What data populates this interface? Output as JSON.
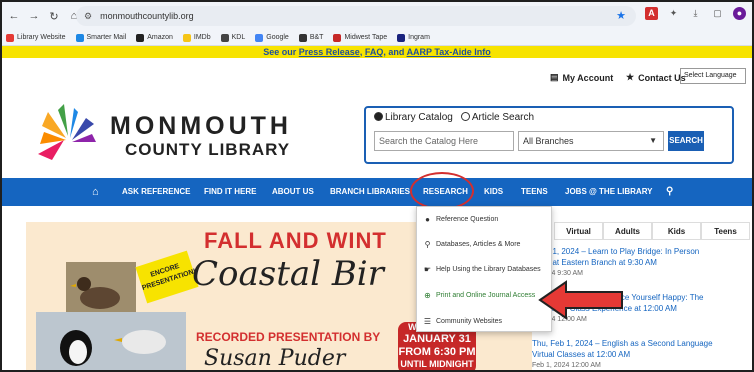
{
  "browser": {
    "url": "monmouthcountylib.org",
    "bookmarks": [
      {
        "label": "Library Website",
        "color": "#e53935"
      },
      {
        "label": "Smarter Mail",
        "color": "#1e88e5"
      },
      {
        "label": "Amazon",
        "color": "#222222"
      },
      {
        "label": "IMDb",
        "color": "#f5c518"
      },
      {
        "label": "KDL",
        "color": "#444444"
      },
      {
        "label": "Google",
        "color": "#4285f4"
      },
      {
        "label": "B&T",
        "color": "#333333"
      },
      {
        "label": "Midwest Tape",
        "color": "#c62828"
      },
      {
        "label": "Ingram",
        "color": "#1a237e"
      }
    ]
  },
  "banner": {
    "prefix": "See our",
    "link1": "Press Release",
    "sep": ",",
    "link2": "FAQ",
    "and": ", and",
    "link3": "AARP Tax-Aide Info"
  },
  "utility": {
    "account": "My Account",
    "contact": "Contact Us",
    "language": "Select Language"
  },
  "logo": {
    "line1": "MONMOUTH",
    "line2": "COUNTY LIBRARY"
  },
  "search": {
    "option1": "Library Catalog",
    "option2": "Article Search",
    "placeholder": "Search the Catalog Here",
    "branch": "All Branches",
    "button": "SEARCH"
  },
  "nav": {
    "items": [
      "ASK REFERENCE",
      "FIND IT HERE",
      "ABOUT US",
      "BRANCH LIBRARIES",
      "RESEARCH",
      "KIDS",
      "TEENS",
      "JOBS @ THE LIBRARY"
    ]
  },
  "dropdown": {
    "items": [
      {
        "label": "Reference Question",
        "icon": "chat-icon"
      },
      {
        "label": "Databases, Articles & More",
        "icon": "search-icon"
      },
      {
        "label": "Help Using the Library Databases",
        "icon": "hand-pointer-icon"
      },
      {
        "label": "Print and Online Journal Access",
        "icon": "plus-circle-icon"
      },
      {
        "label": "Community Websites",
        "icon": "list-icon"
      }
    ]
  },
  "hero": {
    "title": "FALL AND WINT",
    "script": "Coastal Bir",
    "encore": "ENCORE PRESENTATION!",
    "recorded": "RECORDED PRESENTATION BY",
    "name": "Susan Puder",
    "badge": {
      "l1": "WEDNESDAY",
      "l2": "JANUARY 31",
      "l3": "FROM 6:30 PM",
      "l4": "UNTIL MIDNIGHT"
    }
  },
  "events": {
    "tabs": [
      "Virtual",
      "Adults",
      "Kids",
      "Teens"
    ],
    "items": [
      {
        "text": ", Feb 1, 2024 – Learn to Play Bridge: In Person",
        "text2": "gram at Eastern Branch at 9:30 AM",
        "time": "1, 2024 9:30 AM"
      },
      {
        "text": "ence Yourself Happy: The",
        "text2": "cal Dance Class Experience at 12:00 AM",
        "time": "1, 2024 12:00 AM"
      },
      {
        "text": "Thu, Feb 1, 2024 – English as a Second Language",
        "text2": "Virtual Classes at 12:00 AM",
        "time": "Feb 1, 2024 12:00 AM"
      }
    ]
  },
  "colors": {
    "nav": "#1565c0",
    "accent_red": "#d32f2f",
    "banner": "#f7e300"
  }
}
